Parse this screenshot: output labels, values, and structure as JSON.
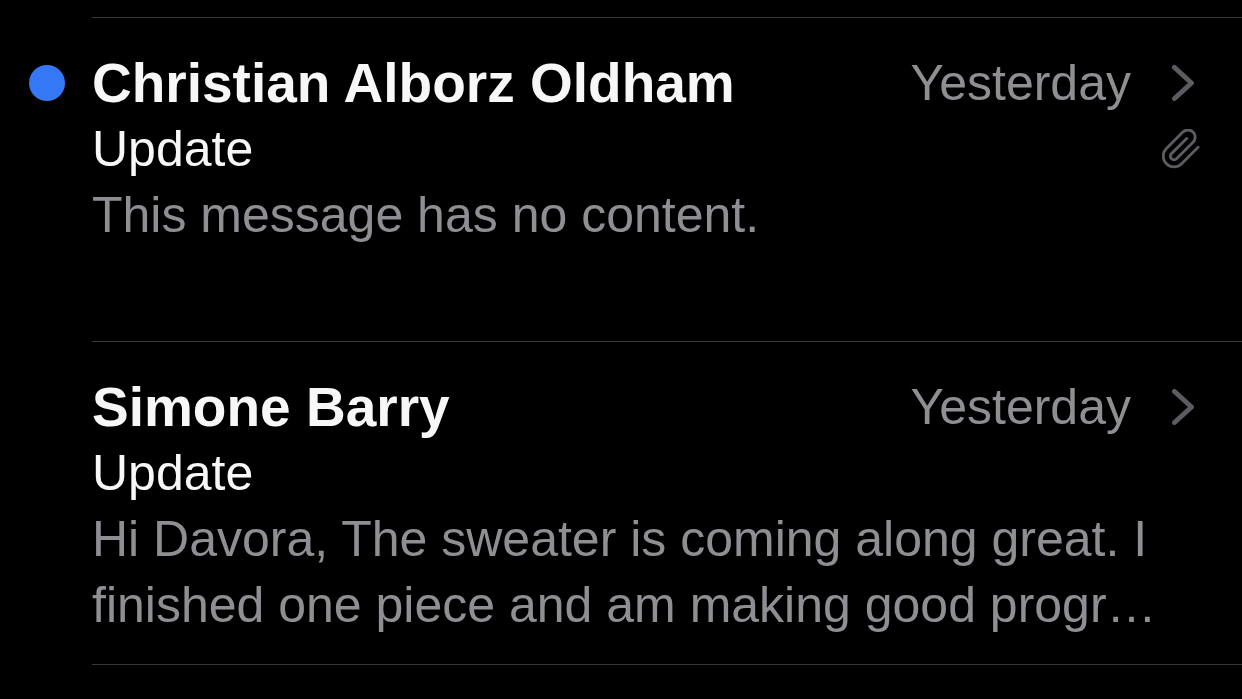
{
  "messages": [
    {
      "unread": true,
      "sender": "Christian Alborz Oldham",
      "date": "Yesterday",
      "subject": "Update",
      "preview": "This message has no content.",
      "attachment": true
    },
    {
      "unread": false,
      "sender": "Simone Barry",
      "date": "Yesterday",
      "subject": "Update",
      "preview": "Hi Davora, The sweater is coming along great. I finished one piece and am making good progr…",
      "attachment": false
    }
  ]
}
